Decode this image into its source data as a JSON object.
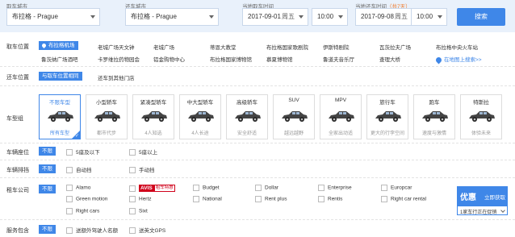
{
  "search": {
    "pickup_city_label": "取车城市",
    "pickup_city_value": "布拉格 - Prague",
    "return_city_label": "还车城市",
    "return_city_value": "布拉格 - Prague",
    "pickup_time_label": "当地取车时间",
    "pickup_date": "2017-09-01",
    "pickup_weekday": "周五",
    "pickup_time": "10:00",
    "return_time_label": "当地还车时间",
    "return_duration": "（共7天）",
    "return_date": "2017-09-08",
    "return_weekday": "周五",
    "return_time": "10:00",
    "search_button": "搜索"
  },
  "pickup_location": {
    "label": "取车位置",
    "items": [
      "布拉格机场",
      "老城广场天文钟",
      "老城广场",
      "蒂恩大教堂",
      "布拉格国家歌剧院",
      "伊斯特剧院",
      "瓦茨拉夫广场",
      "布拉格中央火车站",
      "鲁茨纳广场酒吧",
      "卡罗维拉药物园会",
      "铝金购物中心",
      "布拉格国家博物馆",
      "慕夏博物馆",
      "鲁道夫音乐厅",
      "查理大桥"
    ],
    "map_link": "在地图上搜索>>"
  },
  "return_location": {
    "label": "还车位置",
    "same": "与取车位置相同",
    "other": "还车到其他门店"
  },
  "car_type": {
    "label": "车型组",
    "cards": [
      {
        "name": "不限车型",
        "desc": "所有车型"
      },
      {
        "name": "小型轿车",
        "desc": "都市代步"
      },
      {
        "name": "紧凑型轿车",
        "desc": "4人知选"
      },
      {
        "name": "中大型轿车",
        "desc": "4人长途"
      },
      {
        "name": "高级轿车",
        "desc": "安全舒适"
      },
      {
        "name": "SUV",
        "desc": "越远越野"
      },
      {
        "name": "MPV",
        "desc": "全家出动适"
      },
      {
        "name": "旅行车",
        "desc": "更大的行李空间"
      },
      {
        "name": "跑车",
        "desc": "速度与激情"
      },
      {
        "name": "特斯拉",
        "desc": "体验未来"
      }
    ]
  },
  "seats": {
    "label": "车辆座位",
    "all": "不限",
    "options": [
      "5座及以下",
      "5座以上"
    ]
  },
  "transmission": {
    "label": "车辆排挡",
    "all": "不限",
    "options": [
      "自动挡",
      "手动挡"
    ]
  },
  "company": {
    "label": "租车公司",
    "all": "不限",
    "options": [
      "Alamo",
      "Budget",
      "Dollar",
      "Enterprise",
      "Europcar",
      "Green motion",
      "Hertz",
      "National",
      "Rent plus",
      "Rentis",
      "Right car rental",
      "Right cars",
      "Sixt"
    ],
    "avis_logo": "AVIS",
    "avis_badge": "租车特惠"
  },
  "service": {
    "label": "服务包含",
    "all": "不限",
    "options": [
      "送额外驾驶人名额",
      "送英文GPS"
    ]
  },
  "promo": {
    "badge": "优惠",
    "action": "立即获取",
    "info": "1家车行正在促销"
  },
  "colors": {
    "accent": "#3f87e8",
    "highlight": "#f07a2b",
    "avis": "#d0021b"
  }
}
